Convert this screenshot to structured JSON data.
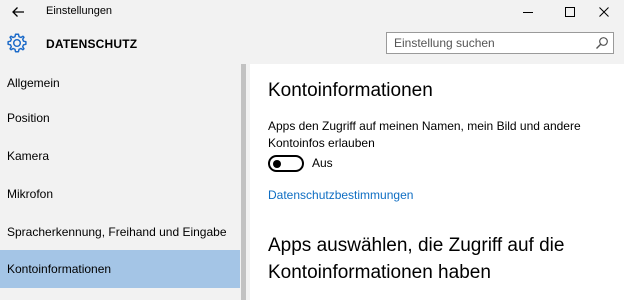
{
  "window": {
    "title": "Einstellungen",
    "back_icon": "back-arrow-icon",
    "controls": [
      "minimize-icon",
      "maximize-icon",
      "close-icon"
    ]
  },
  "header": {
    "icon": "gear-icon",
    "title": "DATENSCHUTZ",
    "search": {
      "placeholder": "Einstellung suchen",
      "value": "",
      "icon": "search-icon"
    }
  },
  "sidebar": {
    "items": [
      {
        "label": "Allgemein",
        "active": false
      },
      {
        "label": "Position",
        "active": false
      },
      {
        "label": "Kamera",
        "active": false
      },
      {
        "label": "Mikrofon",
        "active": false
      },
      {
        "label": "Spracherkennung, Freihand und Eingabe",
        "active": false
      },
      {
        "label": "Kontoinformationen",
        "active": true
      }
    ]
  },
  "main": {
    "heading": "Kontoinformationen",
    "description": "Apps den Zugriff auf meinen Namen, mein Bild und andere Kontoinfos erlauben",
    "toggle": {
      "state": "off",
      "label": "Aus"
    },
    "link": "Datenschutzbestimmungen",
    "subheading": "Apps auswählen, die Zugriff auf die Kontoinformationen haben"
  },
  "colors": {
    "chrome_bg": "#f2f2f2",
    "active_item_bg": "#a4c5e6",
    "link": "#0f6ec3",
    "accent_icon": "#1b6ac9"
  }
}
